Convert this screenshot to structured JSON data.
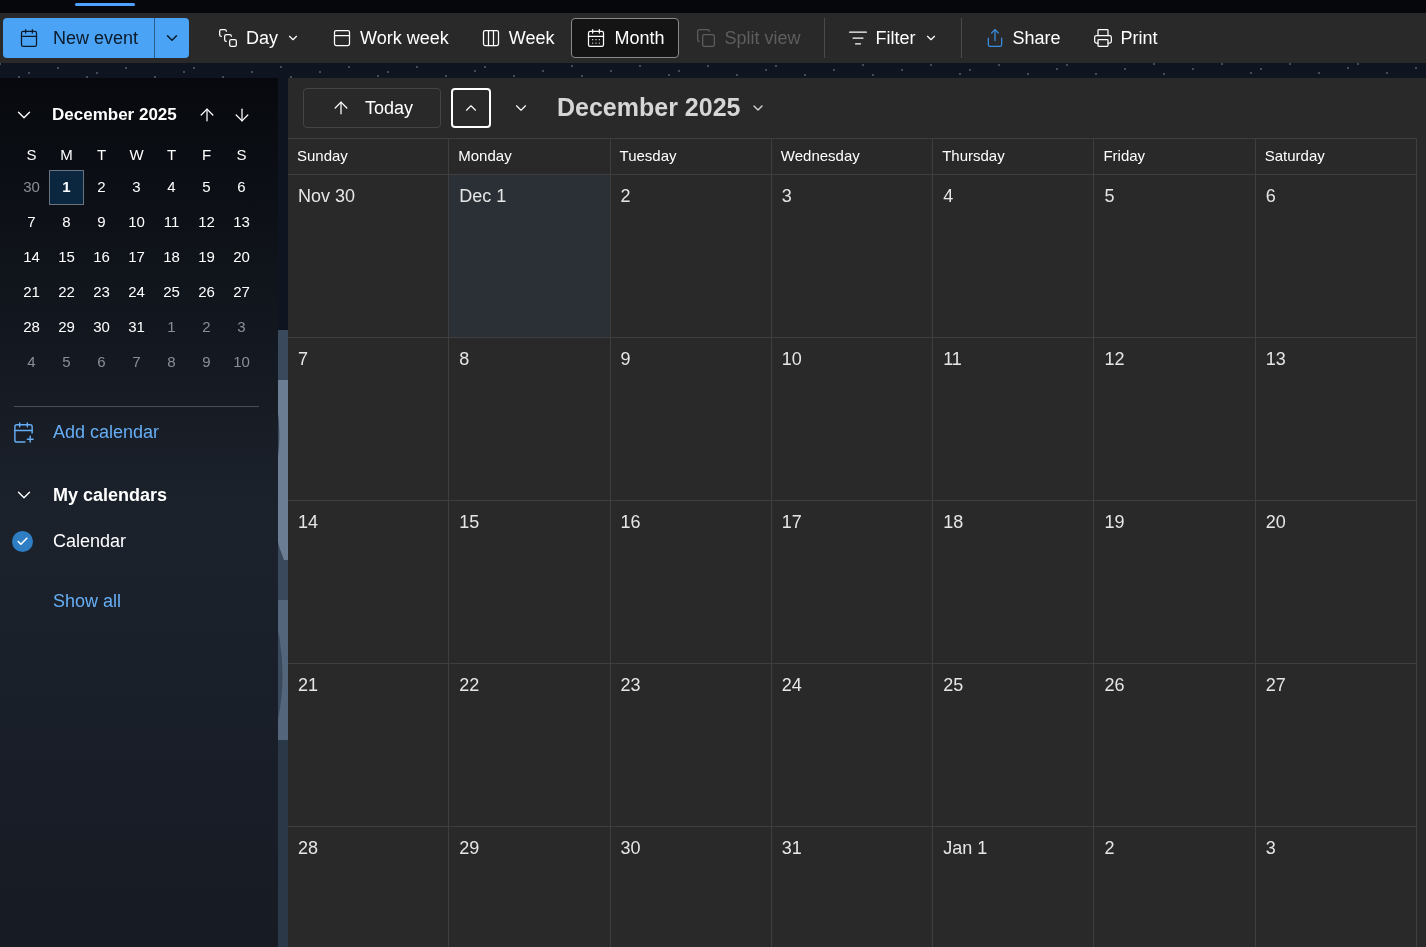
{
  "toolbar": {
    "new_event": {
      "label": "New event"
    },
    "buttons": [
      {
        "kind": "day",
        "label": "Day",
        "dropdown": true,
        "selected": false,
        "disabled": false
      },
      {
        "kind": "workweek",
        "label": "Work week",
        "dropdown": false,
        "selected": false,
        "disabled": false
      },
      {
        "kind": "week",
        "label": "Week",
        "dropdown": false,
        "selected": false,
        "disabled": false
      },
      {
        "kind": "month",
        "label": "Month",
        "dropdown": false,
        "selected": true,
        "disabled": false
      },
      {
        "kind": "split",
        "label": "Split view",
        "dropdown": false,
        "selected": false,
        "disabled": true
      },
      {
        "kind": "divider"
      },
      {
        "kind": "filter",
        "label": "Filter",
        "dropdown": true,
        "selected": false,
        "disabled": false
      },
      {
        "kind": "divider"
      },
      {
        "kind": "share",
        "label": "Share",
        "dropdown": false,
        "selected": false,
        "disabled": false
      },
      {
        "kind": "print",
        "label": "Print",
        "dropdown": false,
        "selected": false,
        "disabled": false
      }
    ]
  },
  "sidebar": {
    "mini_calendar": {
      "title": "December 2025",
      "weekdays": [
        "S",
        "M",
        "T",
        "W",
        "T",
        "F",
        "S"
      ],
      "weeks": [
        [
          {
            "day": "30",
            "in_month": false,
            "selected": false
          },
          {
            "day": "1",
            "in_month": true,
            "selected": true
          },
          {
            "day": "2",
            "in_month": true,
            "selected": false
          },
          {
            "day": "3",
            "in_month": true,
            "selected": false
          },
          {
            "day": "4",
            "in_month": true,
            "selected": false
          },
          {
            "day": "5",
            "in_month": true,
            "selected": false
          },
          {
            "day": "6",
            "in_month": true,
            "selected": false
          }
        ],
        [
          {
            "day": "7",
            "in_month": true,
            "selected": false
          },
          {
            "day": "8",
            "in_month": true,
            "selected": false
          },
          {
            "day": "9",
            "in_month": true,
            "selected": false
          },
          {
            "day": "10",
            "in_month": true,
            "selected": false
          },
          {
            "day": "11",
            "in_month": true,
            "selected": false
          },
          {
            "day": "12",
            "in_month": true,
            "selected": false
          },
          {
            "day": "13",
            "in_month": true,
            "selected": false
          }
        ],
        [
          {
            "day": "14",
            "in_month": true,
            "selected": false
          },
          {
            "day": "15",
            "in_month": true,
            "selected": false
          },
          {
            "day": "16",
            "in_month": true,
            "selected": false
          },
          {
            "day": "17",
            "in_month": true,
            "selected": false
          },
          {
            "day": "18",
            "in_month": true,
            "selected": false
          },
          {
            "day": "19",
            "in_month": true,
            "selected": false
          },
          {
            "day": "20",
            "in_month": true,
            "selected": false
          }
        ],
        [
          {
            "day": "21",
            "in_month": true,
            "selected": false
          },
          {
            "day": "22",
            "in_month": true,
            "selected": false
          },
          {
            "day": "23",
            "in_month": true,
            "selected": false
          },
          {
            "day": "24",
            "in_month": true,
            "selected": false
          },
          {
            "day": "25",
            "in_month": true,
            "selected": false
          },
          {
            "day": "26",
            "in_month": true,
            "selected": false
          },
          {
            "day": "27",
            "in_month": true,
            "selected": false
          }
        ],
        [
          {
            "day": "28",
            "in_month": true,
            "selected": false
          },
          {
            "day": "29",
            "in_month": true,
            "selected": false
          },
          {
            "day": "30",
            "in_month": true,
            "selected": false
          },
          {
            "day": "31",
            "in_month": true,
            "selected": false
          },
          {
            "day": "1",
            "in_month": false,
            "selected": false
          },
          {
            "day": "2",
            "in_month": false,
            "selected": false
          },
          {
            "day": "3",
            "in_month": false,
            "selected": false
          }
        ],
        [
          {
            "day": "4",
            "in_month": false,
            "selected": false
          },
          {
            "day": "5",
            "in_month": false,
            "selected": false
          },
          {
            "day": "6",
            "in_month": false,
            "selected": false
          },
          {
            "day": "7",
            "in_month": false,
            "selected": false
          },
          {
            "day": "8",
            "in_month": false,
            "selected": false
          },
          {
            "day": "9",
            "in_month": false,
            "selected": false
          },
          {
            "day": "10",
            "in_month": false,
            "selected": false
          }
        ]
      ]
    },
    "add_calendar": "Add calendar",
    "my_calendars": {
      "title": "My calendars",
      "expanded": true,
      "items": [
        {
          "label": "Calendar",
          "checked": true,
          "color": "#2f7ec4"
        }
      ]
    },
    "show_all": "Show all"
  },
  "month_view": {
    "today_button": "Today",
    "title": "December 2025",
    "columns": [
      "Sunday",
      "Monday",
      "Tuesday",
      "Wednesday",
      "Thursday",
      "Friday",
      "Saturday"
    ],
    "weeks": [
      [
        {
          "day": "Nov 30",
          "selected": false
        },
        {
          "day": "Dec 1",
          "selected": true
        },
        {
          "day": "2",
          "selected": false
        },
        {
          "day": "3",
          "selected": false
        },
        {
          "day": "4",
          "selected": false
        },
        {
          "day": "5",
          "selected": false
        },
        {
          "day": "6",
          "selected": false
        }
      ],
      [
        {
          "day": "7",
          "selected": false
        },
        {
          "day": "8",
          "selected": false
        },
        {
          "day": "9",
          "selected": false
        },
        {
          "day": "10",
          "selected": false
        },
        {
          "day": "11",
          "selected": false
        },
        {
          "day": "12",
          "selected": false
        },
        {
          "day": "13",
          "selected": false
        }
      ],
      [
        {
          "day": "14",
          "selected": false
        },
        {
          "day": "15",
          "selected": false
        },
        {
          "day": "16",
          "selected": false
        },
        {
          "day": "17",
          "selected": false
        },
        {
          "day": "18",
          "selected": false
        },
        {
          "day": "19",
          "selected": false
        },
        {
          "day": "20",
          "selected": false
        }
      ],
      [
        {
          "day": "21",
          "selected": false
        },
        {
          "day": "22",
          "selected": false
        },
        {
          "day": "23",
          "selected": false
        },
        {
          "day": "24",
          "selected": false
        },
        {
          "day": "25",
          "selected": false
        },
        {
          "day": "26",
          "selected": false
        },
        {
          "day": "27",
          "selected": false
        }
      ],
      [
        {
          "day": "28",
          "selected": false
        },
        {
          "day": "29",
          "selected": false
        },
        {
          "day": "30",
          "selected": false
        },
        {
          "day": "31",
          "selected": false
        },
        {
          "day": "Jan 1",
          "selected": false
        },
        {
          "day": "2",
          "selected": false
        },
        {
          "day": "3",
          "selected": false
        }
      ]
    ]
  }
}
